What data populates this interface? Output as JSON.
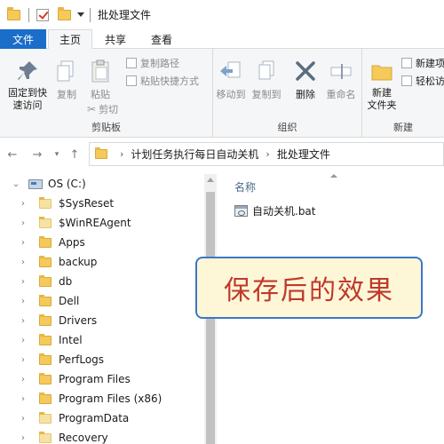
{
  "window": {
    "title": "批处理文件"
  },
  "tabs": {
    "file": "文件",
    "home": "主页",
    "share": "共享",
    "view": "查看"
  },
  "ribbon": {
    "clipboard": {
      "label": "剪贴板",
      "pin": "固定到快\n速访问",
      "copy": "复制",
      "paste": "粘贴",
      "copy_path": "复制路径",
      "paste_shortcut": "粘贴快捷方式",
      "cut": "剪切"
    },
    "organize": {
      "label": "组织",
      "move_to": "移动到",
      "copy_to": "复制到",
      "delete": "删除",
      "rename": "重命名"
    },
    "new": {
      "label": "新建",
      "new_folder": "新建\n文件夹",
      "new_item": "新建项",
      "easy_access": "轻松访"
    }
  },
  "address": {
    "segments": [
      "计划任务执行每日自动关机",
      "批处理文件"
    ]
  },
  "nav": {
    "drive": "OS (C:)",
    "folders": [
      "$SysReset",
      "$WinREAgent",
      "Apps",
      "backup",
      "db",
      "Dell",
      "Drivers",
      "Intel",
      "PerfLogs",
      "Program Files",
      "Program Files (x86)",
      "ProgramData",
      "Recovery"
    ]
  },
  "content": {
    "column_name": "名称",
    "files": [
      {
        "name": "自动关机.bat",
        "icon": "batch-file-icon"
      }
    ]
  },
  "overlay": {
    "caption": "保存后的效果"
  },
  "colors": {
    "accent": "#1a6dc9",
    "callout_border": "#3a78c8",
    "callout_fill": "#fdf7d8",
    "callout_text": "#c0392b"
  }
}
